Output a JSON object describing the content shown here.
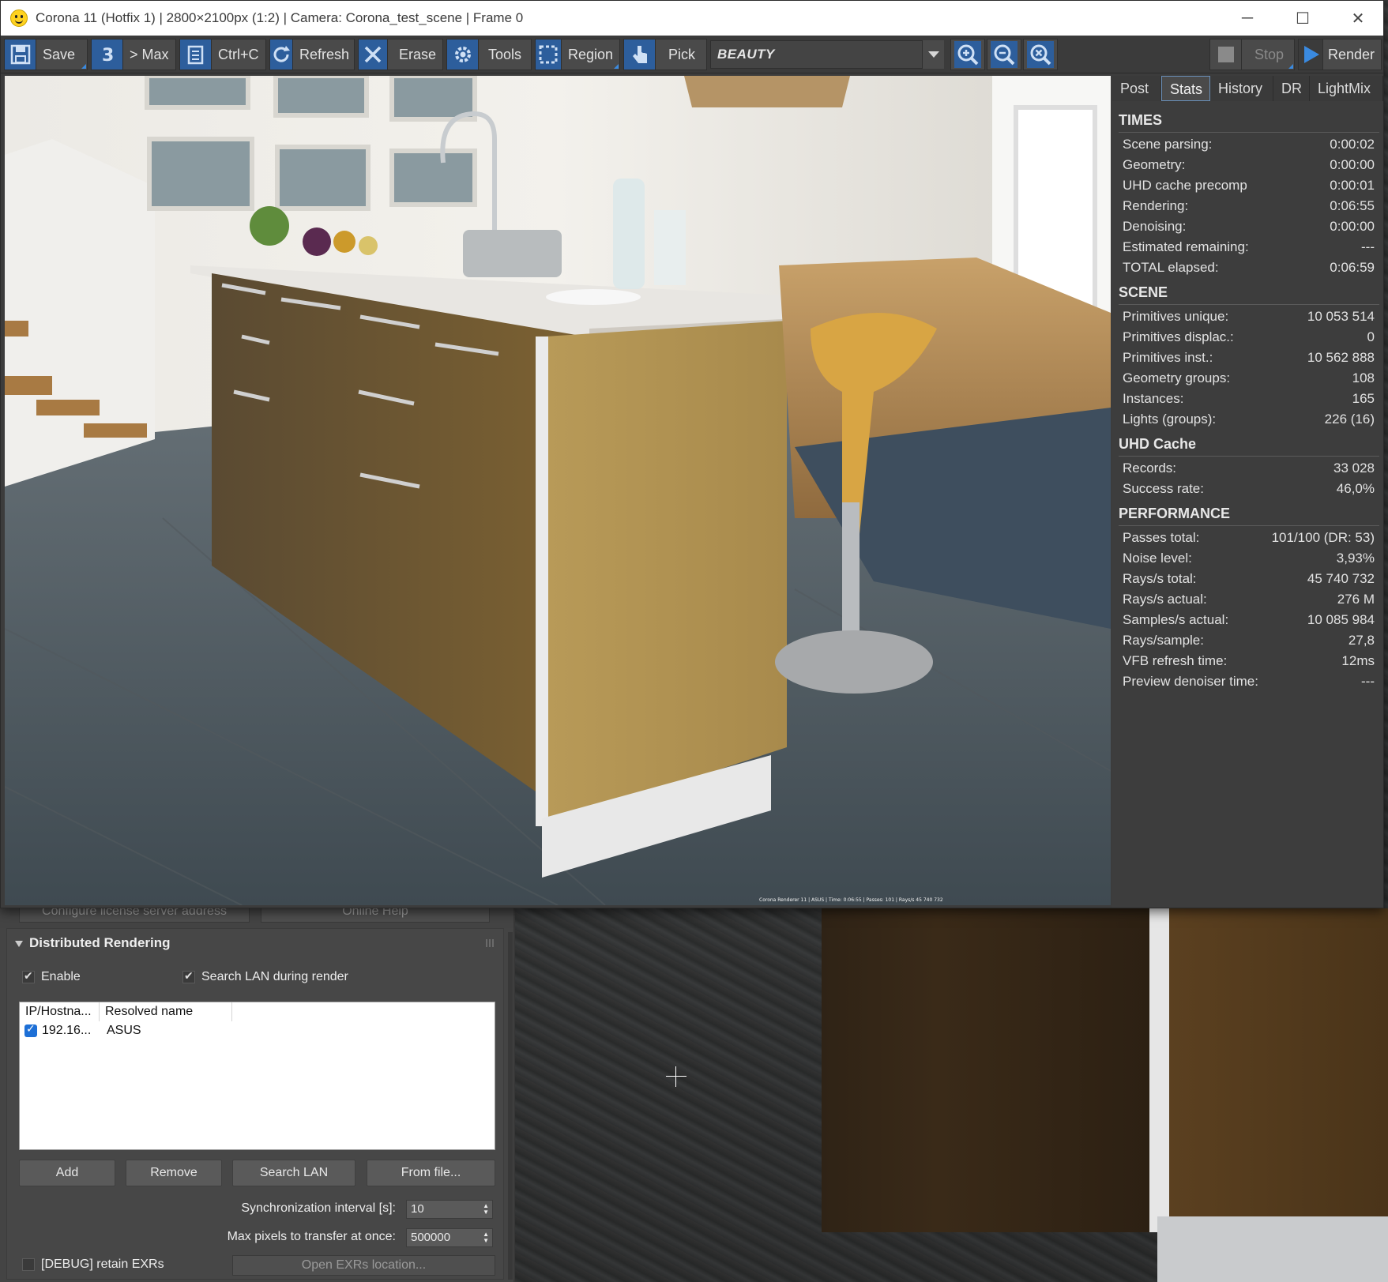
{
  "window": {
    "title": "Corona 11 (Hotfix 1) | 2800×2100px (1:2) | Camera: Corona_test_scene | Frame 0",
    "buttons": {
      "minimize": "─",
      "maximize": "☐",
      "close": "✕"
    }
  },
  "toolbar": {
    "save": "Save",
    "to_max": "> Max",
    "copy": "Ctrl+C",
    "refresh": "Refresh",
    "erase": "Erase",
    "tools": "Tools",
    "region": "Region",
    "pick": "Pick",
    "channel": "BEAUTY",
    "stop": "Stop",
    "render": "Render"
  },
  "side_tabs": [
    "Post",
    "Stats",
    "History",
    "DR",
    "LightMix"
  ],
  "active_tab": "Stats",
  "stats": {
    "times": {
      "title": "TIMES",
      "rows": [
        {
          "label": "Scene parsing:",
          "value": "0:00:02"
        },
        {
          "label": "Geometry:",
          "value": "0:00:00"
        },
        {
          "label": "UHD cache precomp",
          "value": "0:00:01"
        },
        {
          "label": "Rendering:",
          "value": "0:06:55"
        },
        {
          "label": "Denoising:",
          "value": "0:00:00"
        },
        {
          "label": "Estimated remaining:",
          "value": "---"
        },
        {
          "label": "TOTAL elapsed:",
          "value": "0:06:59"
        }
      ]
    },
    "scene": {
      "title": "SCENE",
      "rows": [
        {
          "label": "Primitives unique:",
          "value": "10 053 514"
        },
        {
          "label": "Primitives displac.:",
          "value": "0"
        },
        {
          "label": "Primitives inst.:",
          "value": "10 562 888"
        },
        {
          "label": "Geometry groups:",
          "value": "108"
        },
        {
          "label": "Instances:",
          "value": "165"
        },
        {
          "label": "Lights (groups):",
          "value": "226 (16)"
        }
      ]
    },
    "uhd": {
      "title": "UHD Cache",
      "rows": [
        {
          "label": "Records:",
          "value": "33 028"
        },
        {
          "label": "Success rate:",
          "value": "46,0%"
        }
      ]
    },
    "performance": {
      "title": "PERFORMANCE",
      "rows": [
        {
          "label": "Passes total:",
          "value": "101/100 (DR: 53)"
        },
        {
          "label": "Noise level:",
          "value": "3,93%"
        },
        {
          "label": "Rays/s total:",
          "value": "45 740 732"
        },
        {
          "label": "Rays/s actual:",
          "value": "276 M"
        },
        {
          "label": "Samples/s actual:",
          "value": "10 085 984"
        },
        {
          "label": "Rays/sample:",
          "value": "27,8"
        },
        {
          "label": "VFB refresh time:",
          "value": "12ms"
        },
        {
          "label": "Preview denoiser time:",
          "value": "---"
        }
      ]
    }
  },
  "panel": {
    "license_btn": "Configure license server address",
    "help_btn": "Online Help",
    "rollout_title": "Distributed Rendering",
    "enable": "Enable",
    "search_lan_during": "Search LAN during render",
    "list_headers": [
      "IP/Hostna...",
      "Resolved name"
    ],
    "servers": [
      {
        "ip": "192.16...",
        "name": "ASUS"
      }
    ],
    "add": "Add",
    "remove": "Remove",
    "search_lan": "Search LAN",
    "from_file": "From file...",
    "sync_label": "Synchronization interval [s]:",
    "sync_value": "10",
    "max_pixels_label": "Max pixels to transfer at once:",
    "max_pixels_value": "500000",
    "debug": "[DEBUG] retain EXRs",
    "open_exrs": "Open EXRs location..."
  },
  "colors": {
    "accent": "#2d5e9c",
    "active_tab_border": "#6a8fb8",
    "check_blue": "#1d6fd6"
  }
}
